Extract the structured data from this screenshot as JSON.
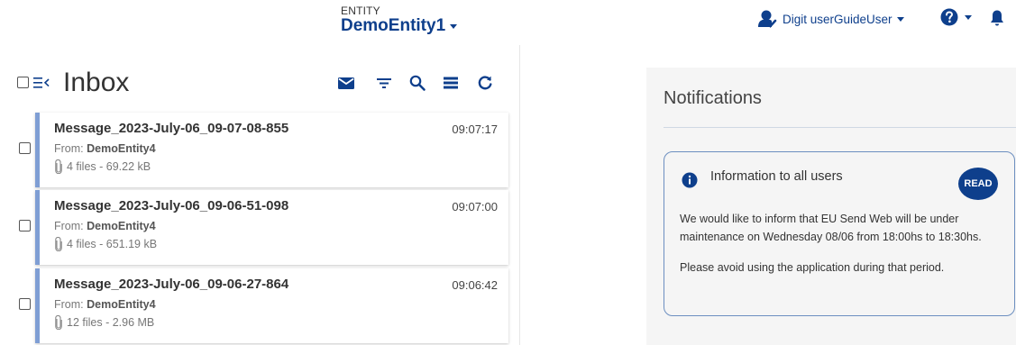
{
  "header": {
    "entity_label": "ENTITY",
    "entity_name": "DemoEntity1",
    "user_name": "Digit userGuideUser"
  },
  "inbox": {
    "title": "Inbox",
    "messages": [
      {
        "subject": "Message_2023-July-06_09-07-08-855",
        "time": "09:07:17",
        "from_label": "From:",
        "from": "DemoEntity4",
        "files": "4 files - 69.22 kB"
      },
      {
        "subject": "Message_2023-July-06_09-06-51-098",
        "time": "09:07:00",
        "from_label": "From:",
        "from": "DemoEntity4",
        "files": "4 files - 651.19 kB"
      },
      {
        "subject": "Message_2023-July-06_09-06-27-864",
        "time": "09:06:42",
        "from_label": "From:",
        "from": "DemoEntity4",
        "files": "12 files - 2.96 MB"
      }
    ]
  },
  "notifications": {
    "title": "Notifications",
    "card": {
      "title": "Information to all users",
      "read_label": "READ",
      "body1": "We would like to inform that EU Send Web will be under maintenance on Wednesday 08/06 from 18:00hs to 18:30hs.",
      "body2": "Please avoid using the application during that period."
    }
  },
  "icons": {
    "user": "user-check-icon",
    "help": "question-circle-icon",
    "bell": "bell-icon",
    "collapse": "collapse-menu-icon",
    "mail": "envelope-icon",
    "filter": "filter-icon",
    "search": "search-icon",
    "list": "list-icon",
    "refresh": "refresh-icon",
    "attachment": "paperclip-icon",
    "info": "info-icon"
  },
  "colors": {
    "brand": "#0e3f8c",
    "accent_bar": "#7f9ed4",
    "panel_bg": "#f5f5f5"
  }
}
